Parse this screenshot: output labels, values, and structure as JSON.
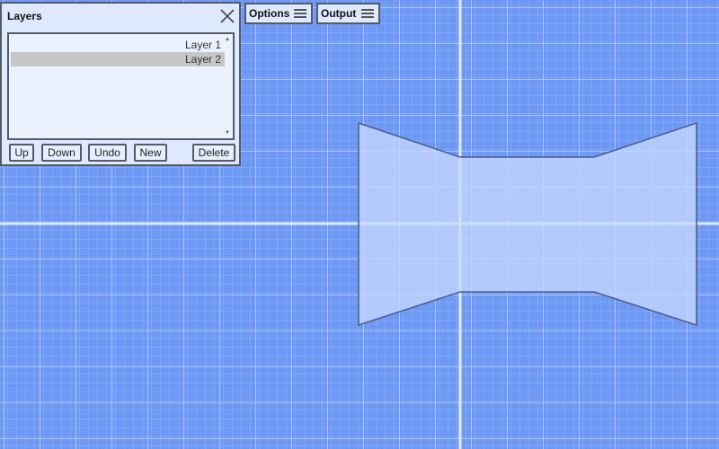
{
  "colors": {
    "workspace_bg": "#6d99f5",
    "grid_minor": "#8fb2f8",
    "grid_major": "#bcd0fb",
    "axis_line": "#e2eafd",
    "shape_fill": "#c8dafd",
    "shape_stroke": "#4c5a86",
    "panel_bg": "#dfe9fd",
    "selected_row": "#c6c6c6"
  },
  "layers_panel": {
    "title": "Layers",
    "close_icon": "close-icon",
    "layers": [
      {
        "label": "Layer 1",
        "selected": false
      },
      {
        "label": "Layer 2",
        "selected": true
      }
    ],
    "buttons": {
      "up": "Up",
      "down": "Down",
      "undo": "Undo",
      "new": "New",
      "delete": "Delete"
    }
  },
  "toolbar": {
    "options_label": "Options",
    "output_label": "Output",
    "menu_icon": "hamburger-menu-icon"
  },
  "canvas": {
    "shape_name": "bowtie-polygon"
  }
}
